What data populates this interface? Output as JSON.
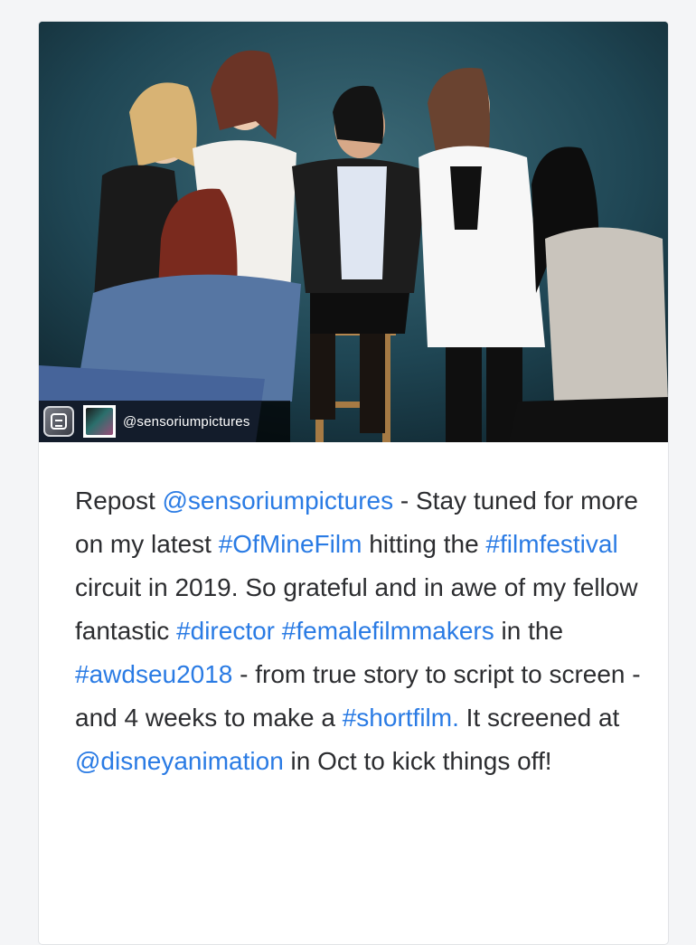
{
  "post": {
    "photo": {
      "description_icon": "group-photo",
      "repost_app_icon": "repost-app-icon",
      "avatar_icon": "sensorium-avatar-icon",
      "repost_handle": "@sensoriumpictures"
    },
    "caption": {
      "segments": [
        {
          "text": "Repost ",
          "link": false
        },
        {
          "text": "@sensoriumpictures",
          "link": true
        },
        {
          "text": " - Stay tuned for more on my latest ",
          "link": false
        },
        {
          "text": "#OfMineFilm",
          "link": true
        },
        {
          "text": " hitting the ",
          "link": false
        },
        {
          "text": "#filmfestival",
          "link": true
        },
        {
          "text": " circuit in 2019. So grateful and in awe of my fellow fantastic ",
          "link": false
        },
        {
          "text": "#director",
          "link": true
        },
        {
          "text": " ",
          "link": false
        },
        {
          "text": "#femalefilmmakers",
          "link": true
        },
        {
          "text": " in the ",
          "link": false
        },
        {
          "text": "#awdseu2018",
          "link": true
        },
        {
          "text": " - from true story to script to screen - and 4 weeks to make a ",
          "link": false
        },
        {
          "text": "#shortfilm.",
          "link": true
        },
        {
          "text": " It screened at ",
          "link": false
        },
        {
          "text": "@disneyanimation",
          "link": true
        },
        {
          "text": " in Oct to kick things off!",
          "link": false
        }
      ]
    }
  },
  "colors": {
    "link": "#2a7be4",
    "text": "#2c2d30",
    "page_bg": "#f4f5f7"
  }
}
